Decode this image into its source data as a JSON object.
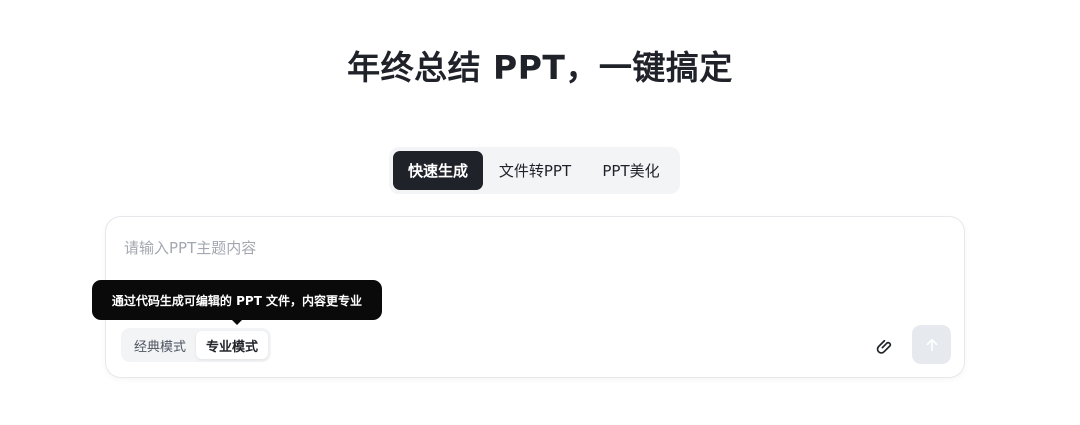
{
  "headline": "年终总结 PPT，一键搞定",
  "tabs": [
    {
      "label": "快速生成",
      "active": true
    },
    {
      "label": "文件转PPT",
      "active": false
    },
    {
      "label": "PPT美化",
      "active": false
    }
  ],
  "input": {
    "value": "",
    "placeholder": "请输入PPT主题内容"
  },
  "modes": [
    {
      "label": "经典模式",
      "active": false
    },
    {
      "label": "专业模式",
      "active": true
    }
  ],
  "tooltip": "通过代码生成可编辑的 PPT 文件，内容更专业",
  "icons": {
    "attach": "paperclip-icon",
    "send": "arrow-up-icon"
  },
  "colors": {
    "primary": "#1f2329",
    "tooltip_bg": "#0a0a0a",
    "send_disabled_bg": "#e6e9ee",
    "placeholder": "#a3a8b0"
  }
}
